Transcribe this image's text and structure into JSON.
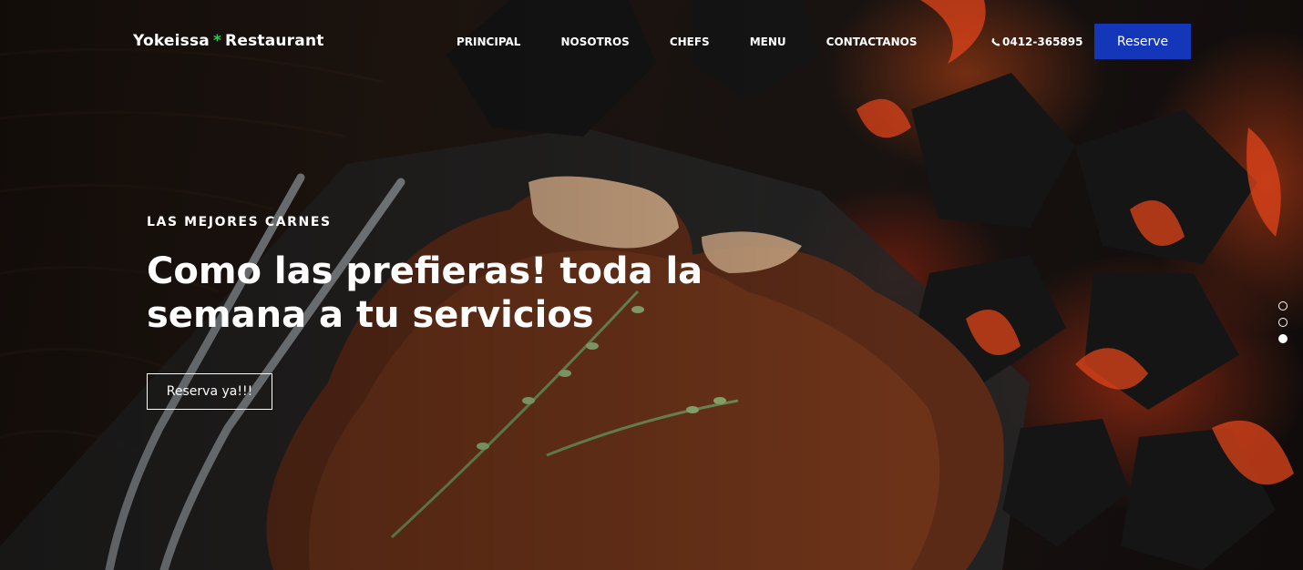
{
  "header": {
    "brand_name": "Yokeissa",
    "brand_star": "*",
    "brand_suffix": "Restaurant",
    "nav": [
      {
        "label": "PRINCIPAL"
      },
      {
        "label": "NOSOTROS"
      },
      {
        "label": "CHEFS"
      },
      {
        "label": "MENU"
      },
      {
        "label": "CONTACTANOS"
      }
    ],
    "phone": "0412-365895",
    "phone_icon": "phone-icon",
    "reserve_label": "Reserve"
  },
  "hero": {
    "eyebrow": "LAS MEJORES CARNES",
    "headline": "Como las prefieras! toda la semana a tu servicios",
    "cta_label": "Reserva ya!!!"
  },
  "slider": {
    "total": 3,
    "active_index": 3
  },
  "colors": {
    "accent_blue": "#1436b8",
    "brand_star_green": "#35c45a"
  }
}
